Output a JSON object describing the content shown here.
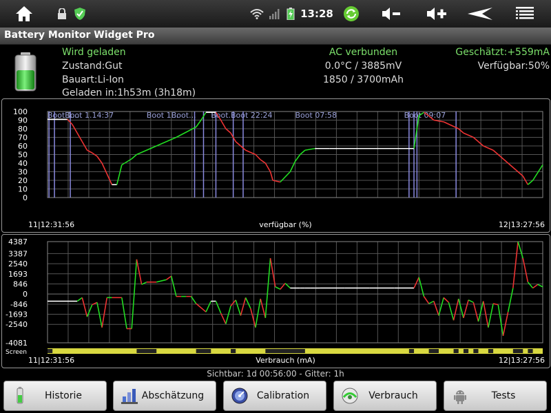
{
  "status_bar": {
    "time": "13:28",
    "icons": [
      "home-icon",
      "lock-icon",
      "shield-icon",
      "wifi-icon",
      "signal-icon",
      "battery-icon",
      "sync-icon",
      "volume-down-icon",
      "volume-up-icon",
      "back-icon",
      "menu-icon"
    ]
  },
  "app": {
    "title": "Battery Monitor Widget Pro"
  },
  "info": {
    "left": [
      "Wird geladen",
      "Zustand:Gut",
      "Bauart:Li-Ion",
      "Geladen in:1h53m (3h18m)"
    ],
    "center": [
      "AC verbunden",
      "0.0°C / 3885mV",
      "1850 / 3700mAh"
    ],
    "right": [
      "Geschätzt:+559mA",
      "Verfügbar:50%"
    ],
    "accent_color": "#7CE06B"
  },
  "chart_data": [
    {
      "type": "line",
      "title": "",
      "xlabel": "verfügbar (%)",
      "ylabel": "",
      "x_start_label": "11|12:31:56",
      "x_end_label": "12|13:27:56",
      "ylim": [
        0,
        100
      ],
      "y_ticks": [
        "100",
        "90",
        "80",
        "70",
        "60",
        "50",
        "40",
        "30",
        "20",
        "10",
        "0"
      ],
      "grid": true,
      "markers": [
        {
          "text": "Boot 1..."
        },
        {
          "text": "Boot 1.14:37"
        },
        {
          "text": "Boot 1..."
        },
        {
          "text": "Boot..."
        },
        {
          "text": "Boot..."
        },
        {
          "text": "Boot 22:24"
        },
        {
          "text": "Boot 07:58"
        },
        {
          "text": "Boot 09:07"
        }
      ],
      "x": [
        0,
        4,
        5,
        6,
        7,
        8,
        9,
        10,
        11,
        13,
        14,
        15,
        17,
        18,
        22,
        26,
        30,
        31,
        32,
        34,
        35,
        36,
        37,
        38,
        39,
        40,
        42,
        43,
        44,
        45,
        45.5,
        47,
        49,
        50,
        51,
        52,
        54,
        57,
        73,
        74,
        75,
        76,
        77,
        78,
        80,
        83,
        84,
        86,
        88,
        90,
        93,
        96,
        97,
        98,
        100
      ],
      "y": [
        91,
        91,
        85,
        75,
        65,
        55,
        52,
        48,
        40,
        15,
        15,
        38,
        45,
        50,
        60,
        70,
        82,
        90,
        99,
        99,
        90,
        80,
        75,
        65,
        60,
        55,
        50,
        44,
        40,
        30,
        20,
        18,
        30,
        42,
        50,
        55,
        57,
        57,
        57,
        57,
        95,
        99,
        95,
        90,
        88,
        80,
        75,
        70,
        60,
        55,
        40,
        25,
        15,
        20,
        38
      ],
      "charge_color": "#22dd22",
      "discharge_color": "#ee3333",
      "idle_color": "#ffffff"
    },
    {
      "type": "line",
      "title": "",
      "xlabel": "Verbrauch (mA)",
      "ylabel": "",
      "x_start_label": "11|12:31:56",
      "x_end_label": "12|13:27:56",
      "ylim": [
        -4081,
        4387
      ],
      "y_ticks": [
        "4387",
        "3387",
        "2540",
        "1693",
        "846",
        "0",
        "-846",
        "-1693",
        "-2540",
        "-4081"
      ],
      "grid": true,
      "screen_label": "Screen",
      "x": [
        0,
        6,
        7,
        8,
        9,
        10,
        11,
        12,
        13,
        15,
        16,
        17,
        18,
        19,
        20,
        22,
        24,
        25,
        26,
        27,
        28,
        29,
        30,
        32,
        33,
        34,
        35,
        36,
        37,
        38,
        39,
        40,
        41,
        42,
        43,
        44,
        45,
        46,
        47,
        48,
        49,
        50,
        51,
        52,
        53,
        54,
        55,
        60,
        65,
        70,
        74,
        75,
        76,
        77,
        78,
        79,
        80,
        81,
        82,
        83,
        84,
        85,
        86,
        87,
        88,
        89,
        90,
        91,
        92,
        93,
        94,
        95,
        96,
        97,
        98,
        99,
        100
      ],
      "y": [
        -600,
        -600,
        -300,
        -1900,
        -900,
        -700,
        -2800,
        -300,
        -300,
        -300,
        -2900,
        -2900,
        2900,
        800,
        1000,
        1000,
        1200,
        1500,
        -200,
        -200,
        -200,
        -200,
        -800,
        -1500,
        -600,
        -600,
        -1600,
        -2500,
        -1000,
        -500,
        -1800,
        -300,
        -1200,
        -2800,
        -400,
        -2000,
        3000,
        600,
        400,
        900,
        500,
        500,
        500,
        500,
        500,
        500,
        500,
        500,
        500,
        500,
        500,
        1400,
        -200,
        -800,
        -600,
        -1800,
        -300,
        -700,
        -2200,
        -400,
        -2000,
        -500,
        -700,
        -2300,
        -600,
        -2800,
        -800,
        -900,
        -3500,
        -1500,
        500,
        4387,
        3000,
        1000,
        500,
        800,
        600
      ],
      "charge_color": "#22dd22",
      "discharge_color": "#ee3333",
      "idle_color": "#ffffff"
    }
  ],
  "footer": {
    "visible_text": "Sichtbar: 1d 00:56:00 - Gitter: 1h"
  },
  "buttons": [
    {
      "label": "Historie",
      "icon": "history-icon"
    },
    {
      "label": "Abschätzung",
      "icon": "estimate-icon"
    },
    {
      "label": "Calibration",
      "icon": "calibration-icon"
    },
    {
      "label": "Verbrauch",
      "icon": "consumption-icon"
    },
    {
      "label": "Tests",
      "icon": "android-icon"
    }
  ]
}
